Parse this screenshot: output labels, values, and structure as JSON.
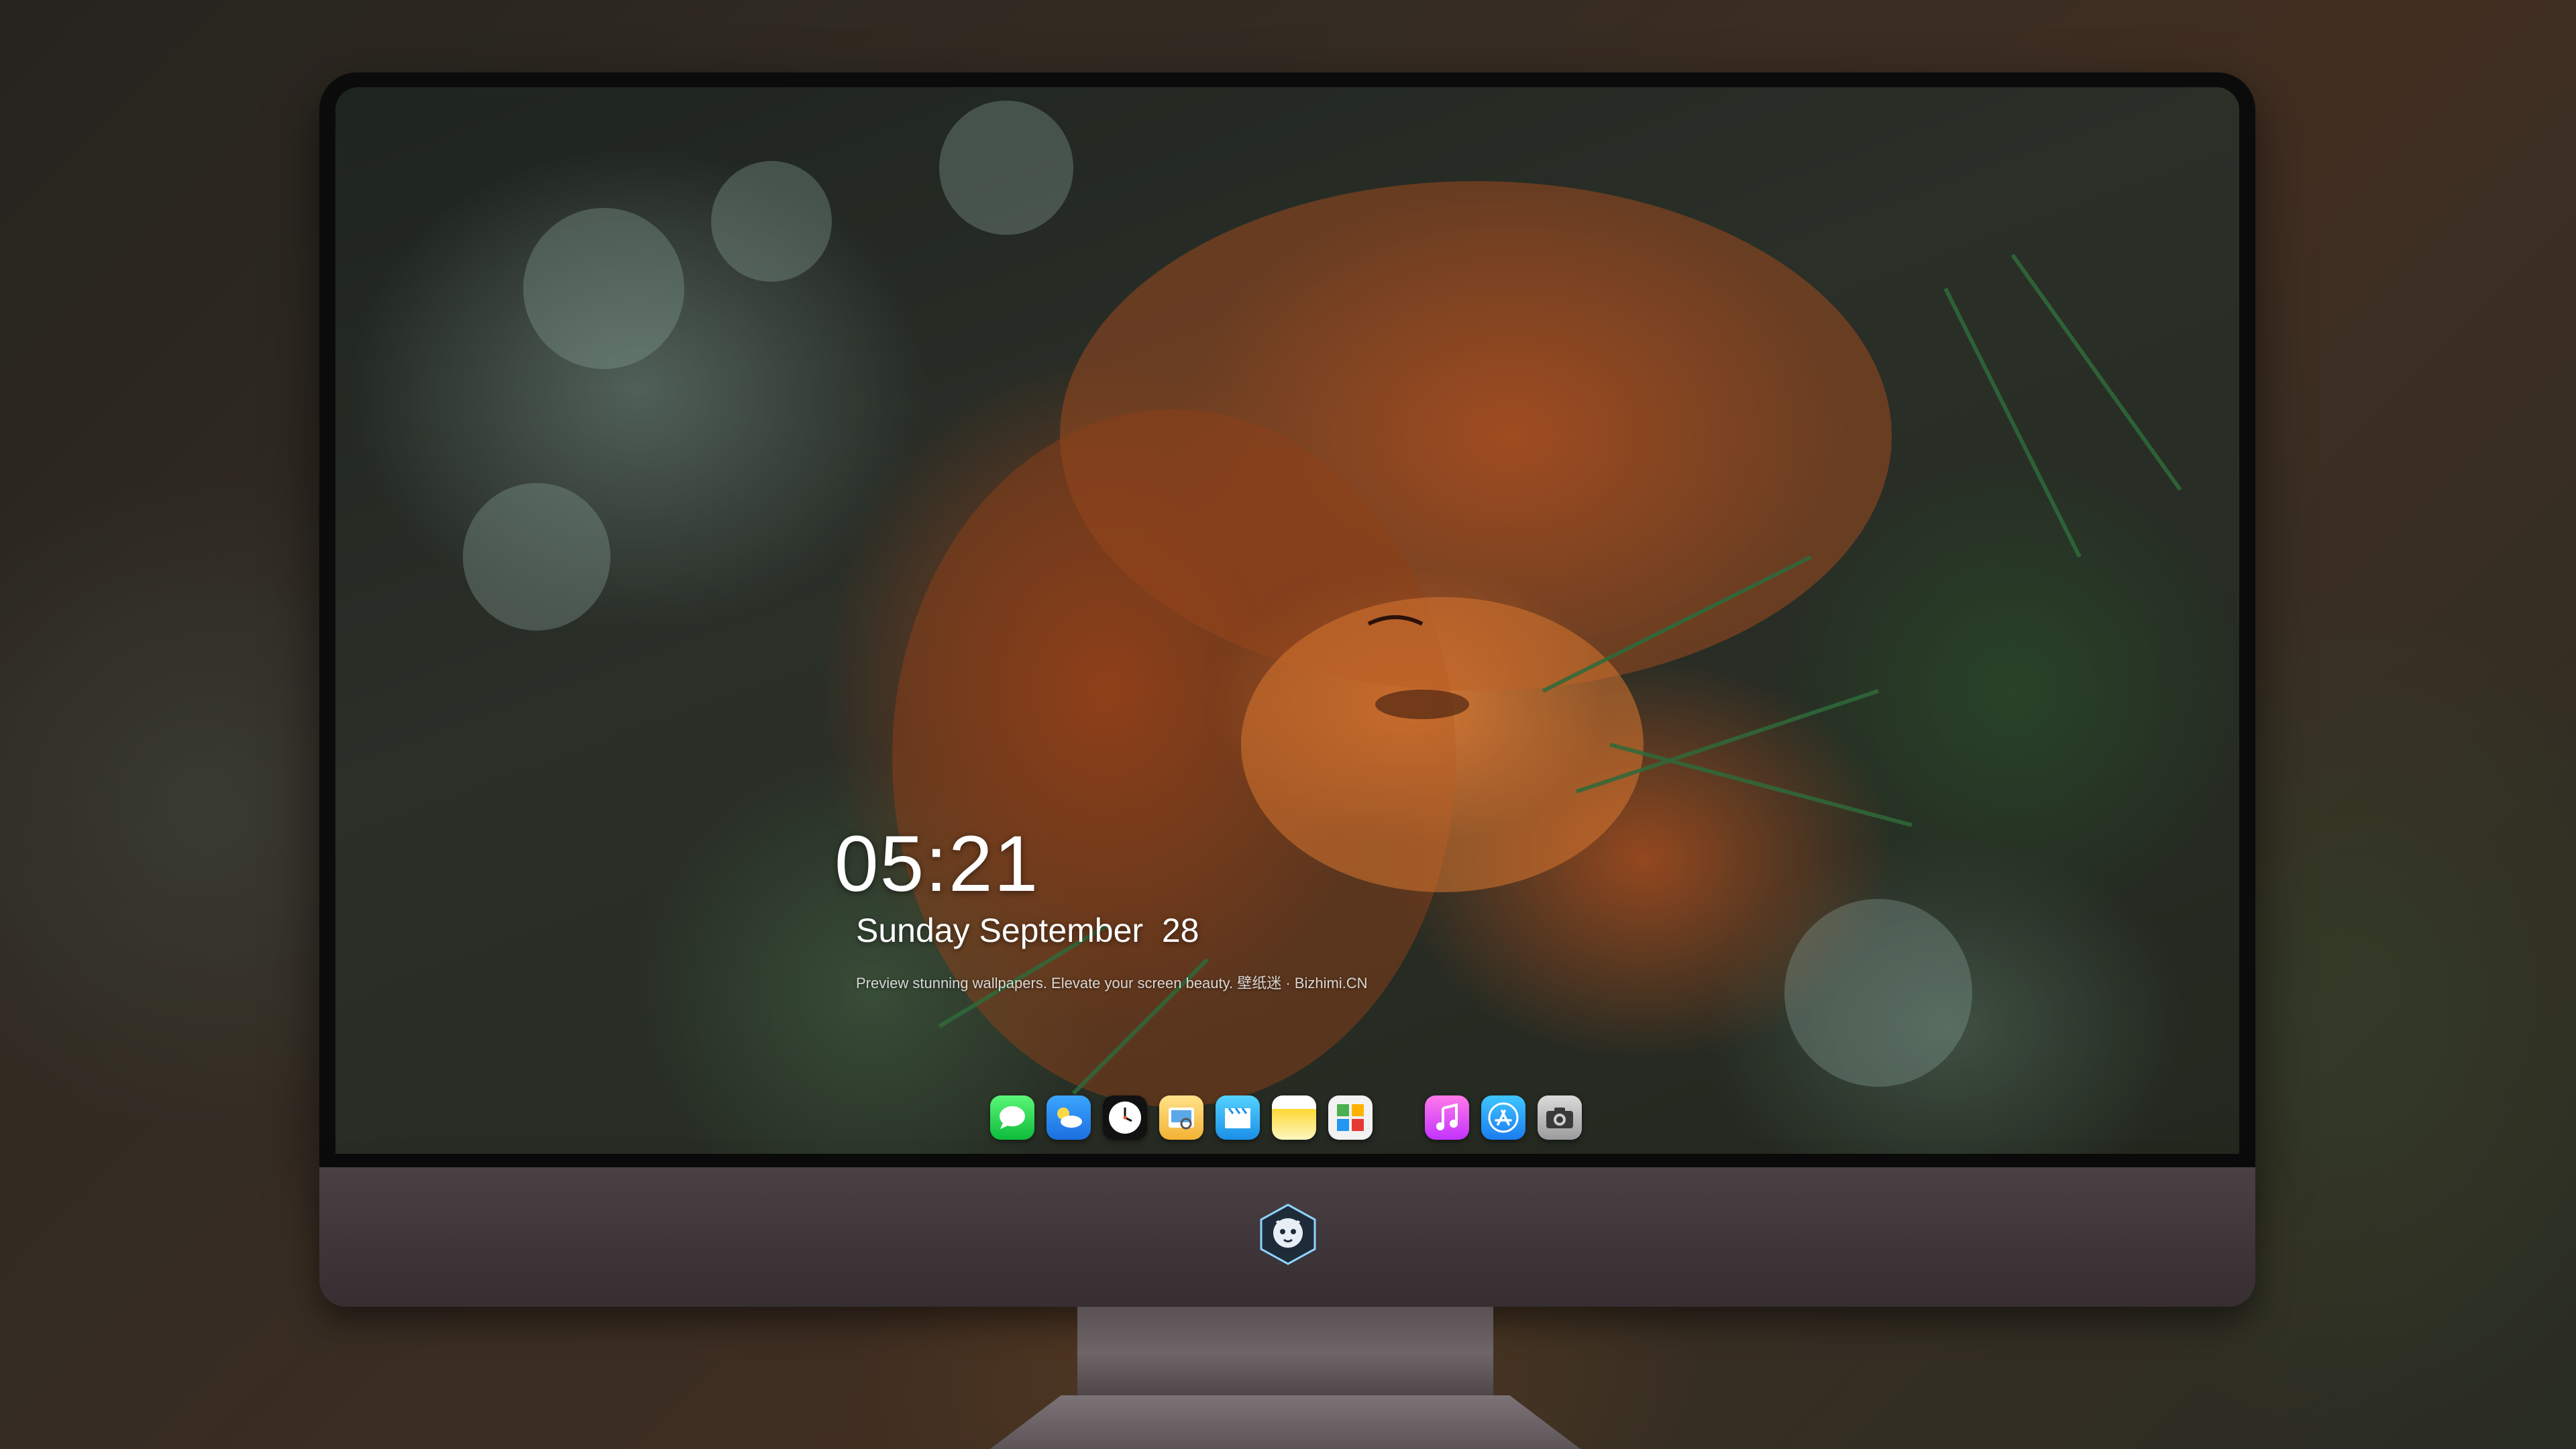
{
  "lock_screen": {
    "time": "05:21",
    "date": "Sunday September  28",
    "tagline": "Preview stunning wallpapers. Elevate your screen beauty. 壁纸迷 · Bizhimi.CN"
  },
  "dock": {
    "apps": [
      {
        "name": "messages-icon",
        "color": "#17c63f"
      },
      {
        "name": "weather-icon",
        "color": "#2a8cf5"
      },
      {
        "name": "clock-icon",
        "color": "#111111"
      },
      {
        "name": "preview-icon",
        "color": "#f3b234"
      },
      {
        "name": "clips-icon",
        "color": "#1a8fe8"
      },
      {
        "name": "notes-icon",
        "color": "#fdd835"
      },
      {
        "name": "photos-icon",
        "color": "#f2f2f2"
      },
      {
        "name": "music-icon",
        "color": "#c333ff"
      },
      {
        "name": "app-store-icon",
        "color": "#1b7cf0"
      },
      {
        "name": "camera-icon",
        "color": "#9c9c9c"
      }
    ]
  },
  "monitor": {
    "chin_logo": "mascot-logo"
  }
}
